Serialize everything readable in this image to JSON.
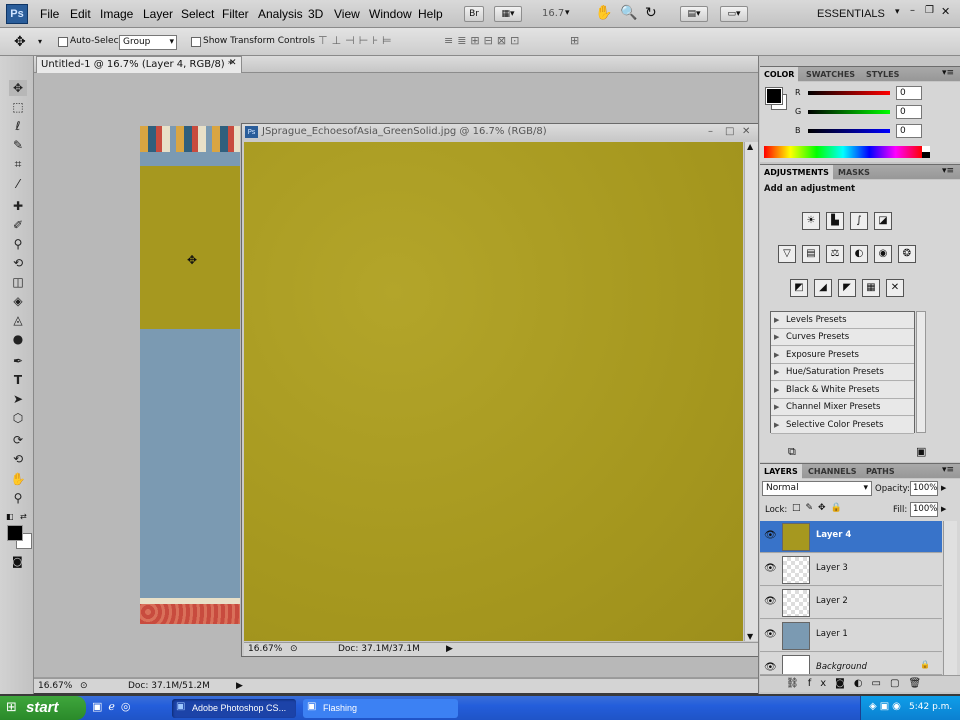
{
  "app": {
    "logo": "Ps",
    "menus": [
      "File",
      "Edit",
      "Image",
      "Layer",
      "Select",
      "Filter",
      "Analysis",
      "3D",
      "View",
      "Window",
      "Help"
    ],
    "bridge_label": "Br",
    "zoom_field": "16.7",
    "workspace": "ESSENTIALS"
  },
  "options": {
    "auto_select_label": "Auto-Select:",
    "auto_select_value": "Group",
    "show_transform": "Show Transform Controls"
  },
  "document_tabs": {
    "active": "Untitled-1 @ 16.7% (Layer 4, RGB/8) *"
  },
  "doc_window": {
    "title": "JSprague_EchoesofAsia_GreenSolid.jpg @ 16.7% (RGB/8)",
    "zoom": "16.67%",
    "doc_size": "Doc: 37.1M/37.1M"
  },
  "main_status": {
    "zoom": "16.67%",
    "doc_size": "Doc: 37.1M/51.2M"
  },
  "color_panel": {
    "tabs": [
      "COLOR",
      "SWATCHES",
      "STYLES"
    ],
    "r_label": "R",
    "g_label": "G",
    "b_label": "B",
    "r": "0",
    "g": "0",
    "b": "0"
  },
  "adjustments_panel": {
    "tabs": [
      "ADJUSTMENTS",
      "MASKS"
    ],
    "heading": "Add an adjustment",
    "presets": [
      "Levels Presets",
      "Curves Presets",
      "Exposure Presets",
      "Hue/Saturation Presets",
      "Black & White Presets",
      "Channel Mixer Presets",
      "Selective Color Presets"
    ]
  },
  "layers_panel": {
    "tabs": [
      "LAYERS",
      "CHANNELS",
      "PATHS"
    ],
    "blend_mode": "Normal",
    "opacity_label": "Opacity:",
    "opacity": "100%",
    "lock_label": "Lock:",
    "fill_label": "Fill:",
    "fill": "100%",
    "layers": [
      {
        "name": "Layer 4",
        "selected": true
      },
      {
        "name": "Layer 3",
        "selected": false
      },
      {
        "name": "Layer 2",
        "selected": false
      },
      {
        "name": "Layer 1",
        "selected": false
      },
      {
        "name": "Background",
        "selected": false
      }
    ]
  },
  "taskbar": {
    "start": "start",
    "tasks": [
      "Adobe Photoshop CS...",
      "Flashing"
    ],
    "clock": "5:42 p.m."
  },
  "colors": {
    "olive": "#a6981f",
    "blue_layer": "#7b9ab2",
    "selection": "#3873c9"
  }
}
